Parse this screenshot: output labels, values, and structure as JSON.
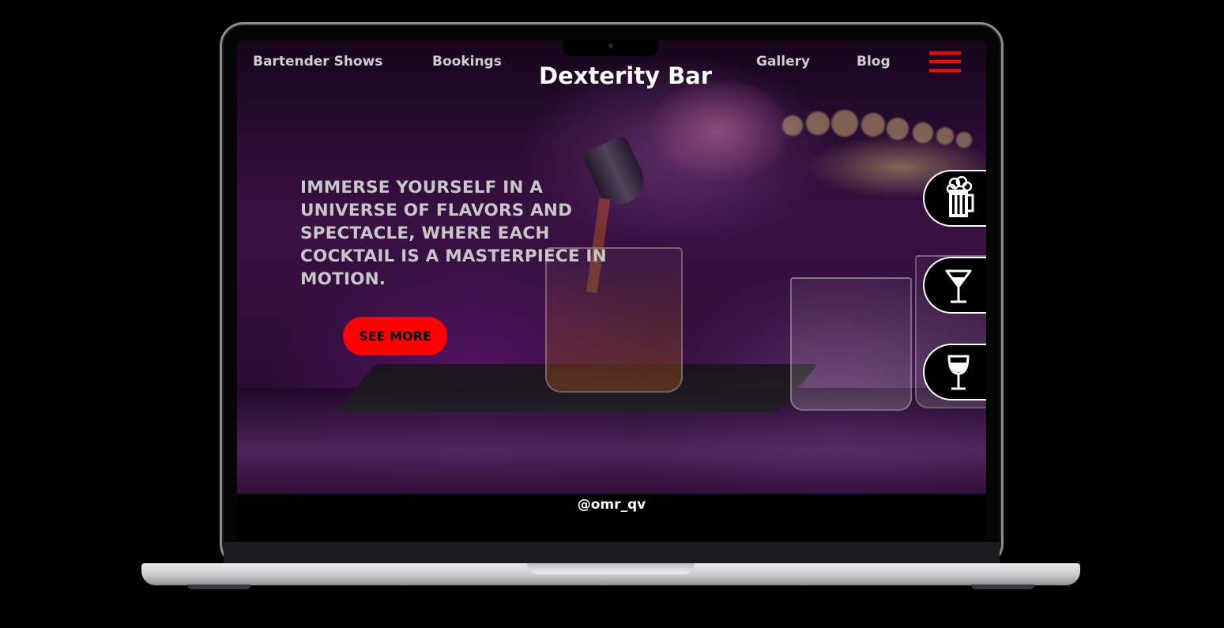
{
  "nav": {
    "left_links": [
      "Bartender Shows",
      "Bookings"
    ],
    "brand": "Dexterity Bar",
    "right_links": [
      "Gallery",
      "Blog"
    ],
    "menu_icon": "hamburger-icon"
  },
  "hero": {
    "headline": "IMMERSE YOURSELF IN A UNIVERSE OF FLAVORS AND SPECTACLE, WHERE EACH COCKTAIL IS A MASTERPIECE IN MOTION.",
    "cta_label": "SEE MORE"
  },
  "side_buttons": [
    {
      "icon": "beer-mug-icon"
    },
    {
      "icon": "martini-glass-icon"
    },
    {
      "icon": "wine-glass-icon"
    }
  ],
  "credit": "@omr_qv",
  "colors": {
    "accent": "#ff0000",
    "background": "#000000",
    "text": "#ffffff",
    "muted_text": "#c7c7c7"
  }
}
